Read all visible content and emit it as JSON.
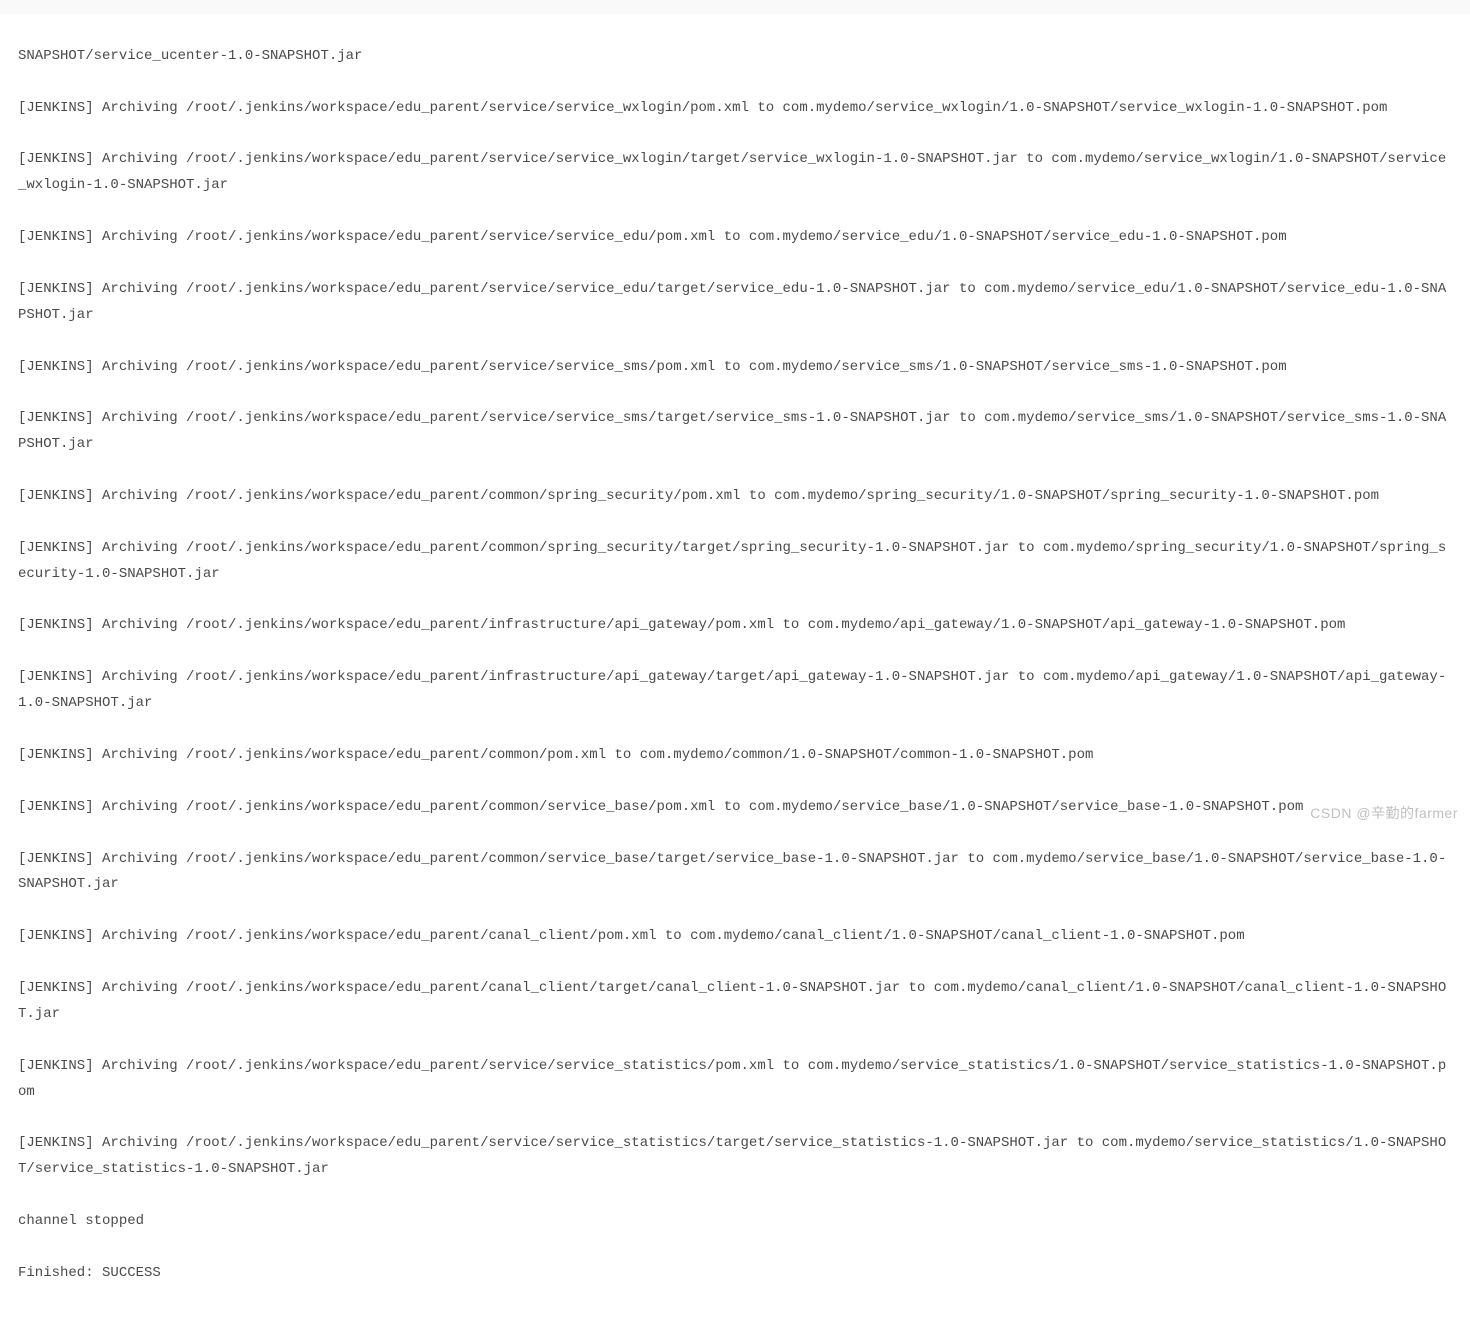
{
  "console": {
    "lines": [
      "SNAPSHOT/service_ucenter-1.0-SNAPSHOT.jar",
      "[JENKINS] Archiving /root/.jenkins/workspace/edu_parent/service/service_wxlogin/pom.xml to com.mydemo/service_wxlogin/1.0-SNAPSHOT/service_wxlogin-1.0-SNAPSHOT.pom",
      "[JENKINS] Archiving /root/.jenkins/workspace/edu_parent/service/service_wxlogin/target/service_wxlogin-1.0-SNAPSHOT.jar to com.mydemo/service_wxlogin/1.0-SNAPSHOT/service_wxlogin-1.0-SNAPSHOT.jar",
      "[JENKINS] Archiving /root/.jenkins/workspace/edu_parent/service/service_edu/pom.xml to com.mydemo/service_edu/1.0-SNAPSHOT/service_edu-1.0-SNAPSHOT.pom",
      "[JENKINS] Archiving /root/.jenkins/workspace/edu_parent/service/service_edu/target/service_edu-1.0-SNAPSHOT.jar to com.mydemo/service_edu/1.0-SNAPSHOT/service_edu-1.0-SNAPSHOT.jar",
      "[JENKINS] Archiving /root/.jenkins/workspace/edu_parent/service/service_sms/pom.xml to com.mydemo/service_sms/1.0-SNAPSHOT/service_sms-1.0-SNAPSHOT.pom",
      "[JENKINS] Archiving /root/.jenkins/workspace/edu_parent/service/service_sms/target/service_sms-1.0-SNAPSHOT.jar to com.mydemo/service_sms/1.0-SNAPSHOT/service_sms-1.0-SNAPSHOT.jar",
      "[JENKINS] Archiving /root/.jenkins/workspace/edu_parent/common/spring_security/pom.xml to com.mydemo/spring_security/1.0-SNAPSHOT/spring_security-1.0-SNAPSHOT.pom",
      "[JENKINS] Archiving /root/.jenkins/workspace/edu_parent/common/spring_security/target/spring_security-1.0-SNAPSHOT.jar to com.mydemo/spring_security/1.0-SNAPSHOT/spring_security-1.0-SNAPSHOT.jar",
      "[JENKINS] Archiving /root/.jenkins/workspace/edu_parent/infrastructure/api_gateway/pom.xml to com.mydemo/api_gateway/1.0-SNAPSHOT/api_gateway-1.0-SNAPSHOT.pom",
      "[JENKINS] Archiving /root/.jenkins/workspace/edu_parent/infrastructure/api_gateway/target/api_gateway-1.0-SNAPSHOT.jar to com.mydemo/api_gateway/1.0-SNAPSHOT/api_gateway-1.0-SNAPSHOT.jar",
      "[JENKINS] Archiving /root/.jenkins/workspace/edu_parent/common/pom.xml to com.mydemo/common/1.0-SNAPSHOT/common-1.0-SNAPSHOT.pom",
      "[JENKINS] Archiving /root/.jenkins/workspace/edu_parent/common/service_base/pom.xml to com.mydemo/service_base/1.0-SNAPSHOT/service_base-1.0-SNAPSHOT.pom",
      "[JENKINS] Archiving /root/.jenkins/workspace/edu_parent/common/service_base/target/service_base-1.0-SNAPSHOT.jar to com.mydemo/service_base/1.0-SNAPSHOT/service_base-1.0-SNAPSHOT.jar",
      "[JENKINS] Archiving /root/.jenkins/workspace/edu_parent/canal_client/pom.xml to com.mydemo/canal_client/1.0-SNAPSHOT/canal_client-1.0-SNAPSHOT.pom",
      "[JENKINS] Archiving /root/.jenkins/workspace/edu_parent/canal_client/target/canal_client-1.0-SNAPSHOT.jar to com.mydemo/canal_client/1.0-SNAPSHOT/canal_client-1.0-SNAPSHOT.jar",
      "[JENKINS] Archiving /root/.jenkins/workspace/edu_parent/service/service_statistics/pom.xml to com.mydemo/service_statistics/1.0-SNAPSHOT/service_statistics-1.0-SNAPSHOT.pom",
      "[JENKINS] Archiving /root/.jenkins/workspace/edu_parent/service/service_statistics/target/service_statistics-1.0-SNAPSHOT.jar to com.mydemo/service_statistics/1.0-SNAPSHOT/service_statistics-1.0-SNAPSHOT.jar",
      "channel stopped",
      "Finished: SUCCESS"
    ]
  },
  "watermark": {
    "text": "CSDN @辛勤的farmer"
  }
}
